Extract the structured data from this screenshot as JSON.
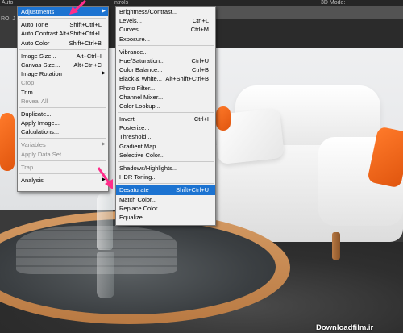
{
  "top_bar": {
    "tab_left": "Auto",
    "tab_mid": "ntrols",
    "tab_right": "3D Mode:",
    "side_text": "RO, J"
  },
  "image_menu": {
    "items": [
      {
        "label": "Adjustments",
        "shortcut": "",
        "submenu": true,
        "highlighted": true
      },
      {
        "sep": true
      },
      {
        "label": "Auto Tone",
        "shortcut": "Shift+Ctrl+L"
      },
      {
        "label": "Auto Contrast",
        "shortcut": "Alt+Shift+Ctrl+L"
      },
      {
        "label": "Auto Color",
        "shortcut": "Shift+Ctrl+B"
      },
      {
        "sep": true
      },
      {
        "label": "Image Size...",
        "shortcut": "Alt+Ctrl+I"
      },
      {
        "label": "Canvas Size...",
        "shortcut": "Alt+Ctrl+C"
      },
      {
        "label": "Image Rotation",
        "shortcut": "",
        "submenu": true
      },
      {
        "label": "Crop",
        "shortcut": "",
        "disabled": true
      },
      {
        "label": "Trim...",
        "shortcut": ""
      },
      {
        "label": "Reveal All",
        "shortcut": "",
        "disabled": true
      },
      {
        "sep": true
      },
      {
        "label": "Duplicate...",
        "shortcut": ""
      },
      {
        "label": "Apply Image...",
        "shortcut": ""
      },
      {
        "label": "Calculations...",
        "shortcut": ""
      },
      {
        "sep": true
      },
      {
        "label": "Variables",
        "shortcut": "",
        "submenu": true,
        "disabled": true
      },
      {
        "label": "Apply Data Set...",
        "shortcut": "",
        "disabled": true
      },
      {
        "sep": true
      },
      {
        "label": "Trap...",
        "shortcut": "",
        "disabled": true
      },
      {
        "sep": true
      },
      {
        "label": "Analysis",
        "shortcut": "",
        "submenu": true
      }
    ]
  },
  "adjustments_menu": {
    "items": [
      {
        "label": "Brightness/Contrast...",
        "shortcut": ""
      },
      {
        "label": "Levels...",
        "shortcut": "Ctrl+L"
      },
      {
        "label": "Curves...",
        "shortcut": "Ctrl+M"
      },
      {
        "label": "Exposure...",
        "shortcut": ""
      },
      {
        "sep": true
      },
      {
        "label": "Vibrance...",
        "shortcut": ""
      },
      {
        "label": "Hue/Saturation...",
        "shortcut": "Ctrl+U"
      },
      {
        "label": "Color Balance...",
        "shortcut": "Ctrl+B"
      },
      {
        "label": "Black & White...",
        "shortcut": "Alt+Shift+Ctrl+B"
      },
      {
        "label": "Photo Filter...",
        "shortcut": ""
      },
      {
        "label": "Channel Mixer...",
        "shortcut": ""
      },
      {
        "label": "Color Lookup...",
        "shortcut": ""
      },
      {
        "sep": true
      },
      {
        "label": "Invert",
        "shortcut": "Ctrl+I"
      },
      {
        "label": "Posterize...",
        "shortcut": ""
      },
      {
        "label": "Threshold...",
        "shortcut": ""
      },
      {
        "label": "Gradient Map...",
        "shortcut": ""
      },
      {
        "label": "Selective Color...",
        "shortcut": ""
      },
      {
        "sep": true
      },
      {
        "label": "Shadows/Highlights...",
        "shortcut": ""
      },
      {
        "label": "HDR Toning...",
        "shortcut": ""
      },
      {
        "sep": true
      },
      {
        "label": "Desaturate",
        "shortcut": "Shift+Ctrl+U",
        "highlighted": true
      },
      {
        "label": "Match Color...",
        "shortcut": ""
      },
      {
        "label": "Replace Color...",
        "shortcut": ""
      },
      {
        "label": "Equalize",
        "shortcut": ""
      }
    ]
  },
  "watermark": "Downloadfilm.ir",
  "colors": {
    "highlight": "#1c73d1",
    "pointer_arrow": "#ff2d8a",
    "menu_bg": "#f0f0f0"
  }
}
